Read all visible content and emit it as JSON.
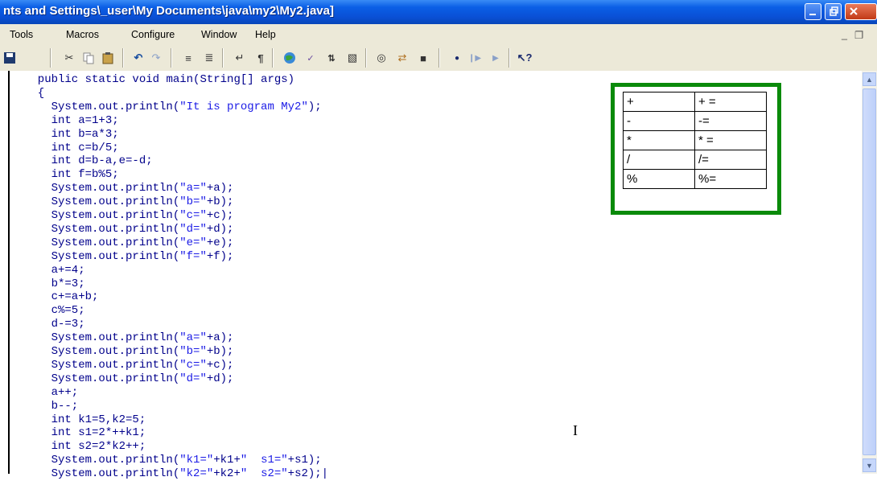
{
  "window": {
    "title": "nts and Settings\\_user\\My Documents\\java\\my2\\My2.java]"
  },
  "menu": [
    "Tools",
    "Macros",
    "Configure",
    "Window",
    "Help"
  ],
  "code_lines": [
    [
      {
        "t": "  public static void ",
        "c": "kw"
      },
      {
        "t": "main(String[] args)",
        "c": "kw"
      }
    ],
    [
      {
        "t": "  {",
        "c": "kw"
      }
    ],
    [
      {
        "t": "    System.out.println(",
        "c": "kw"
      },
      {
        "t": "\"It is program My2\"",
        "c": "st"
      },
      {
        "t": ");",
        "c": "kw"
      }
    ],
    [
      {
        "t": "    int ",
        "c": "kw"
      },
      {
        "t": "a=1+3;",
        "c": "kw"
      }
    ],
    [
      {
        "t": "    int ",
        "c": "kw"
      },
      {
        "t": "b=a*3;",
        "c": "kw"
      }
    ],
    [
      {
        "t": "    int ",
        "c": "kw"
      },
      {
        "t": "c=b/5;",
        "c": "kw"
      }
    ],
    [
      {
        "t": "    int ",
        "c": "kw"
      },
      {
        "t": "d=b-a,e=-d;",
        "c": "kw"
      }
    ],
    [
      {
        "t": "    int ",
        "c": "kw"
      },
      {
        "t": "f=b%5;",
        "c": "kw"
      }
    ],
    [
      {
        "t": "    System.out.println(",
        "c": "kw"
      },
      {
        "t": "\"a=\"",
        "c": "st"
      },
      {
        "t": "+a);",
        "c": "kw"
      }
    ],
    [
      {
        "t": "    System.out.println(",
        "c": "kw"
      },
      {
        "t": "\"b=\"",
        "c": "st"
      },
      {
        "t": "+b);",
        "c": "kw"
      }
    ],
    [
      {
        "t": "    System.out.println(",
        "c": "kw"
      },
      {
        "t": "\"c=\"",
        "c": "st"
      },
      {
        "t": "+c);",
        "c": "kw"
      }
    ],
    [
      {
        "t": "    System.out.println(",
        "c": "kw"
      },
      {
        "t": "\"d=\"",
        "c": "st"
      },
      {
        "t": "+d);",
        "c": "kw"
      }
    ],
    [
      {
        "t": "    System.out.println(",
        "c": "kw"
      },
      {
        "t": "\"e=\"",
        "c": "st"
      },
      {
        "t": "+e);",
        "c": "kw"
      }
    ],
    [
      {
        "t": "    System.out.println(",
        "c": "kw"
      },
      {
        "t": "\"f=\"",
        "c": "st"
      },
      {
        "t": "+f);",
        "c": "kw"
      }
    ],
    [
      {
        "t": "    a+=4;",
        "c": "kw"
      }
    ],
    [
      {
        "t": "    b*=3;",
        "c": "kw"
      }
    ],
    [
      {
        "t": "    c+=a+b;",
        "c": "kw"
      }
    ],
    [
      {
        "t": "    c%=5;",
        "c": "kw"
      }
    ],
    [
      {
        "t": "    d-=3;",
        "c": "kw"
      }
    ],
    [
      {
        "t": "    System.out.println(",
        "c": "kw"
      },
      {
        "t": "\"a=\"",
        "c": "st"
      },
      {
        "t": "+a);",
        "c": "kw"
      }
    ],
    [
      {
        "t": "    System.out.println(",
        "c": "kw"
      },
      {
        "t": "\"b=\"",
        "c": "st"
      },
      {
        "t": "+b);",
        "c": "kw"
      }
    ],
    [
      {
        "t": "    System.out.println(",
        "c": "kw"
      },
      {
        "t": "\"c=\"",
        "c": "st"
      },
      {
        "t": "+c);",
        "c": "kw"
      }
    ],
    [
      {
        "t": "    System.out.println(",
        "c": "kw"
      },
      {
        "t": "\"d=\"",
        "c": "st"
      },
      {
        "t": "+d);",
        "c": "kw"
      }
    ],
    [
      {
        "t": "    a++;",
        "c": "kw"
      }
    ],
    [
      {
        "t": "    b--;",
        "c": "kw"
      }
    ],
    [
      {
        "t": "    int ",
        "c": "kw"
      },
      {
        "t": "k1=5,k2=5;",
        "c": "kw"
      }
    ],
    [
      {
        "t": "    int ",
        "c": "kw"
      },
      {
        "t": "s1=2*++k1;",
        "c": "kw"
      }
    ],
    [
      {
        "t": "    int ",
        "c": "kw"
      },
      {
        "t": "s2=2*k2++;",
        "c": "kw"
      }
    ],
    [
      {
        "t": "    System.out.println(",
        "c": "kw"
      },
      {
        "t": "\"k1=\"",
        "c": "st"
      },
      {
        "t": "+k1+",
        "c": "kw"
      },
      {
        "t": "\"  s1=\"",
        "c": "st"
      },
      {
        "t": "+s1);",
        "c": "kw"
      }
    ],
    [
      {
        "t": "    System.out.println(",
        "c": "kw"
      },
      {
        "t": "\"k2=\"",
        "c": "st"
      },
      {
        "t": "+k2+",
        "c": "kw"
      },
      {
        "t": "\"  s2=\"",
        "c": "st"
      },
      {
        "t": "+s2);|",
        "c": "kw"
      }
    ]
  ],
  "operators_table": [
    [
      "+",
      "+ ="
    ],
    [
      "-",
      "-="
    ],
    [
      "*",
      "* ="
    ],
    [
      "/",
      "/="
    ],
    [
      "%",
      "%="
    ]
  ],
  "colors": {
    "keyword": "#00008b",
    "string": "#1a1ae6",
    "ops_border": "#0a8a0a",
    "titlebar": "#0a50d6"
  },
  "icons": [
    "save-icon",
    "cut-icon",
    "copy-icon",
    "paste-icon",
    "undo-icon",
    "redo-icon",
    "indent-icon",
    "outdent-icon",
    "wrap-icon",
    "pilcrow-icon",
    "globe-icon",
    "spellcheck-icon",
    "sort-icon",
    "find-icon",
    "view-icon",
    "replace-icon",
    "binoculars-icon",
    "record-icon",
    "pause-icon",
    "play-icon",
    "help-cursor-icon"
  ]
}
